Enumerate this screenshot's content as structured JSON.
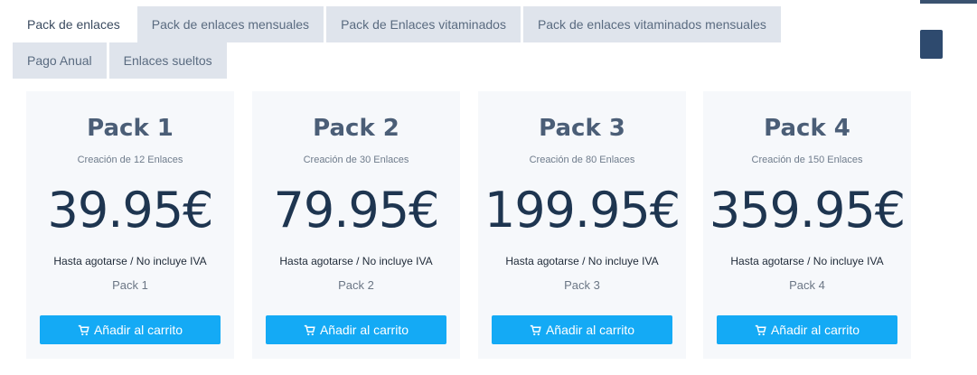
{
  "tabs": [
    {
      "label": "Pack de enlaces",
      "active": true
    },
    {
      "label": "Pack de enlaces mensuales",
      "active": false
    },
    {
      "label": "Pack de Enlaces vitaminados",
      "active": false
    },
    {
      "label": "Pack de enlaces vitaminados mensuales",
      "active": false
    },
    {
      "label": "Pago Anual",
      "active": false
    },
    {
      "label": "Enlaces sueltos",
      "active": false
    }
  ],
  "cards": [
    {
      "title": "Pack 1",
      "subtitle": "Creación de 12 Enlaces",
      "price": "39.95€",
      "note": "Hasta agotarse / No incluye IVA",
      "name": "Pack 1",
      "button": "Añadir al carrito"
    },
    {
      "title": "Pack 2",
      "subtitle": "Creación de 30 Enlaces",
      "price": "79.95€",
      "note": "Hasta agotarse / No incluye IVA",
      "name": "Pack 2",
      "button": "Añadir al carrito"
    },
    {
      "title": "Pack 3",
      "subtitle": "Creación de 80 Enlaces",
      "price": "199.95€",
      "note": "Hasta agotarse / No incluye IVA",
      "name": "Pack 3",
      "button": "Añadir al carrito"
    },
    {
      "title": "Pack 4",
      "subtitle": "Creación de 150 Enlaces",
      "price": "359.95€",
      "note": "Hasta agotarse / No incluye IVA",
      "name": "Pack 4",
      "button": "Añadir al carrito"
    }
  ],
  "icons": {
    "cart": "shopping-cart-icon"
  },
  "colors": {
    "button": "#14aaf5",
    "price": "#1e3550",
    "tab_inactive": "#dfe4ec",
    "card_bg": "#f6f8fb",
    "side_button": "#2e4a6e"
  }
}
